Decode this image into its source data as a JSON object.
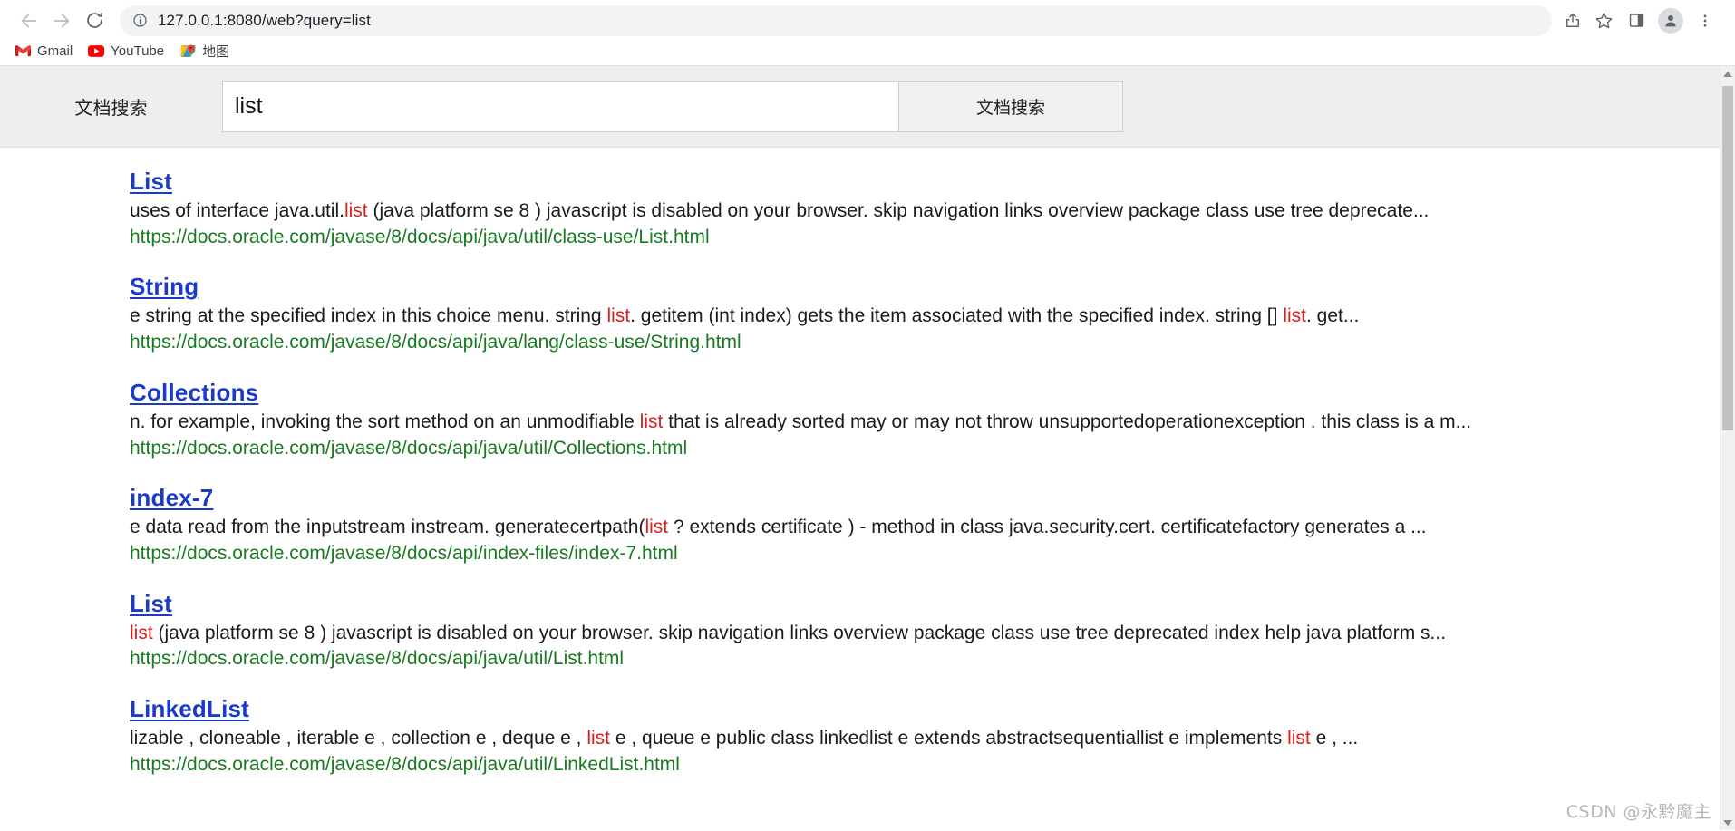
{
  "browser": {
    "back_label": "Back",
    "forward_label": "Forward",
    "reload_label": "Reload",
    "url": "127.0.0.1:8080/web?query=list",
    "site_info_icon": "info-circle-icon",
    "share_label": "Share this page",
    "bookmark_label": "Bookmark this tab",
    "sidepanel_label": "Side panel",
    "profile_label": "Profile",
    "menu_label": "Customize and control Google Chrome",
    "bookmarks": [
      {
        "label": "Gmail",
        "icon": "gmail-icon"
      },
      {
        "label": "YouTube",
        "icon": "youtube-icon"
      },
      {
        "label": "地图",
        "icon": "google-maps-icon"
      }
    ]
  },
  "search": {
    "heading": "文档搜索",
    "query_value": "list",
    "placeholder": "",
    "submit_label": "文档搜索"
  },
  "results": [
    {
      "title": "List",
      "snippet_parts": [
        {
          "text": "uses of interface java.util.",
          "highlight": false
        },
        {
          "text": "list",
          "highlight": true
        },
        {
          "text": " (java platform se 8 ) javascript is disabled on your browser. skip navigation links overview package class use tree deprecate...",
          "highlight": false
        }
      ],
      "url": "https://docs.oracle.com/javase/8/docs/api/java/util/class-use/List.html"
    },
    {
      "title": "String",
      "snippet_parts": [
        {
          "text": "e string at the specified index in this choice menu. string ",
          "highlight": false
        },
        {
          "text": "list",
          "highlight": true
        },
        {
          "text": ". getitem (int index) gets the item associated with the specified index. string [] ",
          "highlight": false
        },
        {
          "text": "list",
          "highlight": true
        },
        {
          "text": ". get...",
          "highlight": false
        }
      ],
      "url": "https://docs.oracle.com/javase/8/docs/api/java/lang/class-use/String.html"
    },
    {
      "title": "Collections",
      "snippet_parts": [
        {
          "text": "n. for example, invoking the sort method on an unmodifiable ",
          "highlight": false
        },
        {
          "text": "list",
          "highlight": true
        },
        {
          "text": " that is already sorted may or may not throw unsupportedoperationexception . this class is a m...",
          "highlight": false
        }
      ],
      "url": "https://docs.oracle.com/javase/8/docs/api/java/util/Collections.html"
    },
    {
      "title": "index-7",
      "snippet_parts": [
        {
          "text": "e data read from the inputstream instream. generatecertpath(",
          "highlight": false
        },
        {
          "text": "list",
          "highlight": true
        },
        {
          "text": " ? extends certificate ) - method in class java.security.cert. certificatefactory generates a ...",
          "highlight": false
        }
      ],
      "url": "https://docs.oracle.com/javase/8/docs/api/index-files/index-7.html"
    },
    {
      "title": "List",
      "snippet_parts": [
        {
          "text": "list",
          "highlight": true
        },
        {
          "text": " (java platform se 8 ) javascript is disabled on your browser. skip navigation links overview package class use tree deprecated index help java platform s...",
          "highlight": false
        }
      ],
      "url": "https://docs.oracle.com/javase/8/docs/api/java/util/List.html"
    },
    {
      "title": "LinkedList",
      "snippet_parts": [
        {
          "text": "lizable , cloneable , iterable e , collection e , deque e , ",
          "highlight": false
        },
        {
          "text": "list",
          "highlight": true
        },
        {
          "text": " e , queue e public class linkedlist e extends abstractsequentiallist e implements ",
          "highlight": false
        },
        {
          "text": "list",
          "highlight": true
        },
        {
          "text": " e , ...",
          "highlight": false
        }
      ],
      "url": "https://docs.oracle.com/javase/8/docs/api/java/util/LinkedList.html"
    }
  ],
  "watermark": "CSDN @永黔魔主",
  "colors": {
    "link_blue": "#1a3bc9",
    "highlight_red": "#e01b1b",
    "url_green": "#1a7a22",
    "header_bg": "#eeeeee"
  }
}
